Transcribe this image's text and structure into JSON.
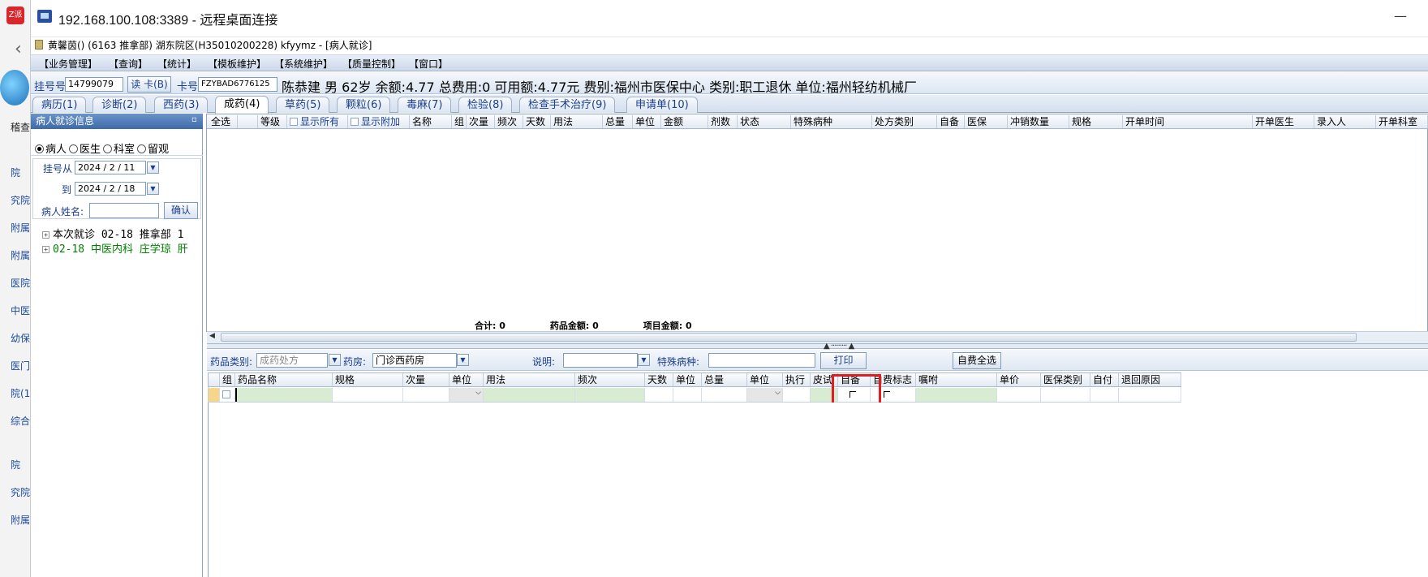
{
  "window": {
    "title": "192.168.100.108:3389 - 远程桌面连接",
    "app_subtitle": "黄馨茵() (6163 推拿部) 湖东院区(H35010200228) kfyymz - [病人就诊]"
  },
  "host_sidebar": {
    "logo_text": "Z派",
    "items": [
      "稽查",
      "院",
      "究院",
      "附属",
      "附属",
      "医院",
      "中医",
      "幼保",
      "医门",
      "院(1",
      "综合",
      "院",
      "究院",
      "附属"
    ]
  },
  "menu": [
    "【业务管理】",
    "【查询】",
    "【统计】",
    "【模板维护】",
    "【系统维护】",
    "【质量控制】",
    "【窗口】"
  ],
  "infobar": {
    "reg_label": "挂号号",
    "reg_value": "14799079",
    "read_card_button": "读 卡(B)",
    "card_label": "卡号",
    "card_value": "FZYBAD6776125",
    "patient_line": "陈恭建 男 62岁 余额:4.77 总费用:0 可用额:4.77元 费别:福州市医保中心 类别:职工退休 单位:福州轻纺机械厂"
  },
  "tabs": [
    "病历(1)",
    "诊断(2)",
    "西药(3)",
    "成药(4)",
    "草药(5)",
    "颗粒(6)",
    "毒麻(7)",
    "检验(8)",
    "检查手术治疗(9)",
    "申请单(10)"
  ],
  "active_tab": "成药(4)",
  "left_panel": {
    "header": "病人就诊信息",
    "radios": [
      "病人",
      "医生",
      "科室",
      "留观"
    ],
    "selected_radio": "病人",
    "from_label": "挂号从",
    "from_date": "2024 / 2 / 11",
    "to_label": "到",
    "to_date": "2024 / 2 / 18",
    "name_label": "病人姓名:",
    "name_value": "",
    "confirm_button": "确认",
    "tree": [
      {
        "text": "本次就诊 02-18 推拿部 1",
        "color": "#000000"
      },
      {
        "text": "02-18 中医内科 庄学琼 肝",
        "color": "#008000"
      }
    ]
  },
  "top_grid": {
    "columns": [
      "全选",
      "",
      "等级",
      "显示所有",
      "显示附加",
      "名称",
      "组",
      "次量",
      "频次",
      "天数",
      "用法",
      "总量",
      "单位",
      "金额",
      "剂数",
      "状态",
      "特殊病种",
      "处方类别",
      "自备",
      "医保",
      "冲销数量",
      "规格",
      "开单时间",
      "开单医生",
      "录入人",
      "开单科室"
    ],
    "totals": "合计: 0　　　　　药品金额: 0　　　　　项目金额: 0"
  },
  "bottom_bar": {
    "drug_type_label": "药品类别:",
    "drug_type_value": "成药处方",
    "pharmacy_label": "药房:",
    "pharmacy_value": "门诊西药房",
    "note_label": "说明:",
    "note_value": "",
    "special_label": "特殊病种:",
    "special_value": "",
    "print_button": "打印",
    "self_pay_all_button": "自费全选"
  },
  "bottom_grid": {
    "columns": [
      "组",
      "药品名称",
      "规格",
      "次量",
      "单位",
      "用法",
      "频次",
      "天数",
      "单位",
      "总量",
      "单位",
      "执行",
      "皮试",
      "自备",
      "自费标志",
      "嘱咐",
      "单价",
      "医保类别",
      "自付",
      "退回原因"
    ]
  },
  "accent_colors": {
    "highlight": "#e02020",
    "header_blue": "#3d6aa8",
    "green_cell": "#d8ecd2"
  }
}
